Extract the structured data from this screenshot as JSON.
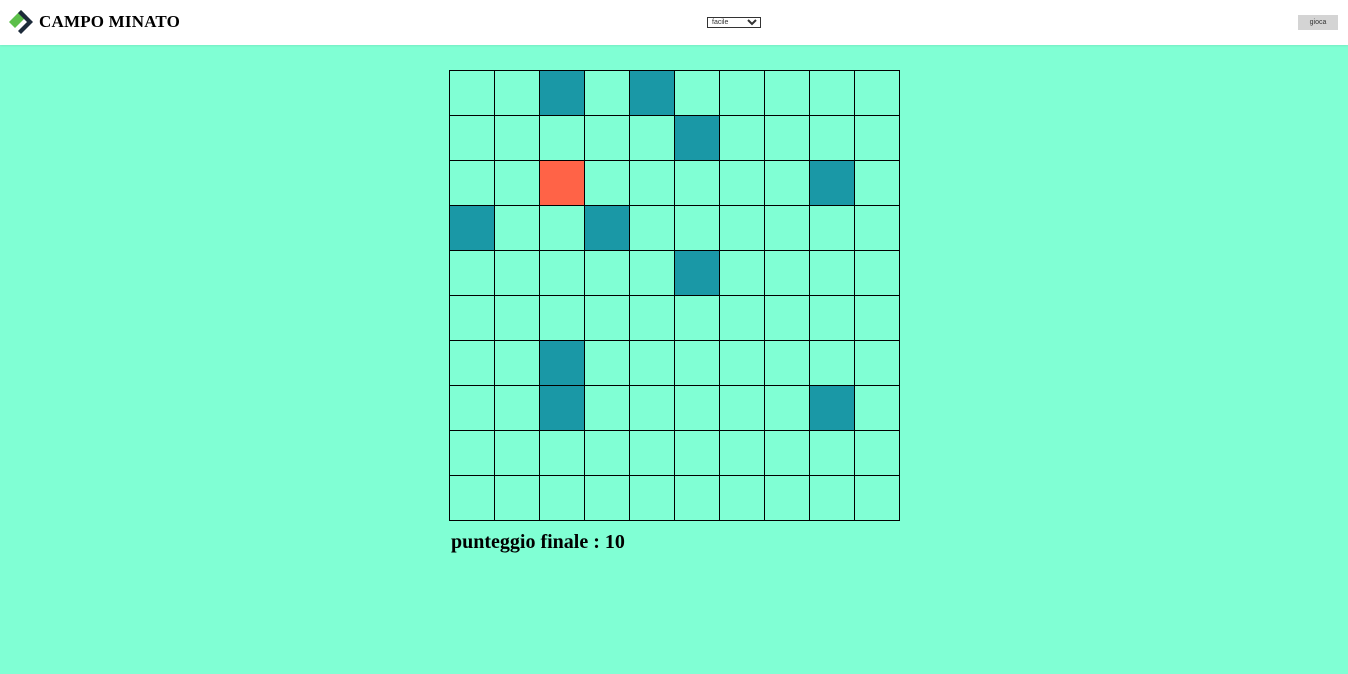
{
  "header": {
    "title": "CAMPO MINATO",
    "difficulty_selected": "facile",
    "play_label": "gioca"
  },
  "colors": {
    "background": "#80ffd4",
    "revealed_cell": "#1a98a6",
    "bomb_cell": "#ff6347",
    "logo_green": "#5cbf4a",
    "logo_dark": "#1d2b3a"
  },
  "board": {
    "rows": 10,
    "cols": 10,
    "cells": [
      [
        "hidden",
        "hidden",
        "safe",
        "hidden",
        "safe",
        "hidden",
        "hidden",
        "hidden",
        "hidden",
        "hidden"
      ],
      [
        "hidden",
        "hidden",
        "hidden",
        "hidden",
        "hidden",
        "safe",
        "hidden",
        "hidden",
        "hidden",
        "hidden"
      ],
      [
        "hidden",
        "hidden",
        "bomb",
        "hidden",
        "hidden",
        "hidden",
        "hidden",
        "hidden",
        "safe",
        "hidden"
      ],
      [
        "safe",
        "hidden",
        "hidden",
        "safe",
        "hidden",
        "hidden",
        "hidden",
        "hidden",
        "hidden",
        "hidden"
      ],
      [
        "hidden",
        "hidden",
        "hidden",
        "hidden",
        "hidden",
        "safe",
        "hidden",
        "hidden",
        "hidden",
        "hidden"
      ],
      [
        "hidden",
        "hidden",
        "hidden",
        "hidden",
        "hidden",
        "hidden",
        "hidden",
        "hidden",
        "hidden",
        "hidden"
      ],
      [
        "hidden",
        "hidden",
        "safe",
        "hidden",
        "hidden",
        "hidden",
        "hidden",
        "hidden",
        "hidden",
        "hidden"
      ],
      [
        "hidden",
        "hidden",
        "safe",
        "hidden",
        "hidden",
        "hidden",
        "hidden",
        "hidden",
        "safe",
        "hidden"
      ],
      [
        "hidden",
        "hidden",
        "hidden",
        "hidden",
        "hidden",
        "hidden",
        "hidden",
        "hidden",
        "hidden",
        "hidden"
      ],
      [
        "hidden",
        "hidden",
        "hidden",
        "hidden",
        "hidden",
        "hidden",
        "hidden",
        "hidden",
        "hidden",
        "hidden"
      ]
    ]
  },
  "score": {
    "text": "punteggio finale : 10"
  }
}
